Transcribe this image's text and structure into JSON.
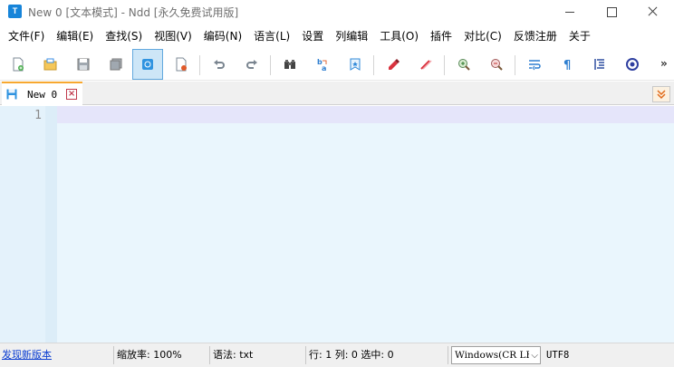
{
  "window": {
    "title": "New 0 [文本模式] - Ndd [永久免费试用版]",
    "app_icon_letter": "T"
  },
  "menu": [
    "文件(F)",
    "编辑(E)",
    "查找(S)",
    "视图(V)",
    "编码(N)",
    "语言(L)",
    "设置",
    "列编辑",
    "工具(O)",
    "插件",
    "对比(C)",
    "反馈注册",
    "关于"
  ],
  "toolbar": {
    "buttons": [
      {
        "name": "new-file-icon",
        "active": false
      },
      {
        "name": "open-folder-icon",
        "active": false
      },
      {
        "name": "save-icon",
        "active": false
      },
      {
        "name": "save-all-icon",
        "active": false
      },
      {
        "name": "file-status-icon",
        "active": true
      },
      {
        "name": "close-file-icon",
        "active": false
      },
      {
        "name": "undo-icon",
        "active": false
      },
      {
        "name": "redo-icon",
        "active": false
      },
      {
        "name": "find-icon",
        "active": false
      },
      {
        "name": "replace-icon",
        "active": false
      },
      {
        "name": "bookmark-icon",
        "active": false
      },
      {
        "name": "marker-icon",
        "active": false
      },
      {
        "name": "clear-mark-icon",
        "active": false
      },
      {
        "name": "zoom-in-icon",
        "active": false
      },
      {
        "name": "zoom-out-icon",
        "active": false
      },
      {
        "name": "word-wrap-icon",
        "active": false
      },
      {
        "name": "show-symbols-icon",
        "active": false
      },
      {
        "name": "indent-guide-icon",
        "active": false
      },
      {
        "name": "settings-wheel-icon",
        "active": false
      }
    ],
    "more": "»"
  },
  "tabs": [
    {
      "label": "New 0",
      "close": "×"
    }
  ],
  "editor": {
    "line_numbers": [
      "1"
    ],
    "content": ""
  },
  "statusbar": {
    "update_link": "发现新版本",
    "zoom": "缩放率: 100%",
    "language": "语法: txt",
    "position": "行: 1 列: 0 选中: 0",
    "eol": "Windows(CR LF)",
    "encoding": "UTF8"
  },
  "colors": {
    "accent_tab": "#f7a830",
    "active_button_bg": "#cde6f7",
    "editor_bg": "#eaf6fd",
    "current_line": "#e5e5fa",
    "link": "#0b3dd1"
  }
}
